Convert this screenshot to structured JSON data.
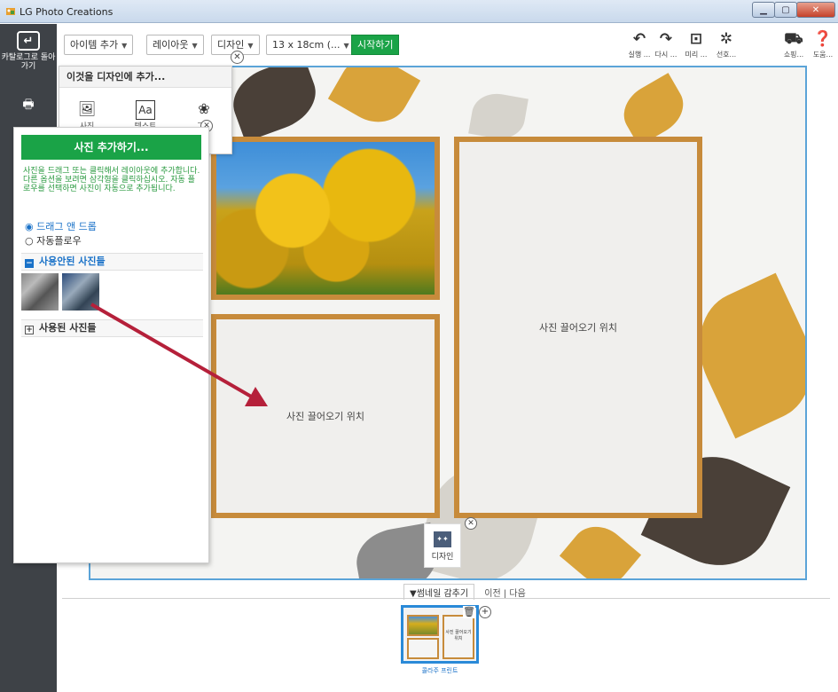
{
  "window": {
    "title": "LG Photo Creations"
  },
  "rail": {
    "back_label": "카탈로그로 돌아가기"
  },
  "toolbar": {
    "add_item": "아이템 추가",
    "layout": "레이아웃",
    "design": "디자인",
    "size": "13 x 18cm (...",
    "start": "시작하기",
    "undo": "실행 ...",
    "redo": "다시 ...",
    "preview": "미리 ...",
    "prefs": "선호...",
    "shop": "쇼핑...",
    "help": "도움..."
  },
  "add_popup": {
    "header": "이것을 디자인에 추가...",
    "items": [
      "사진",
      "텍스트",
      "그래"
    ]
  },
  "panel": {
    "add_photo": "사진 추가하기...",
    "help_text": "사진을 드래그 또는 클릭해서 레이아웃에 추가합니다. 다른 옵션을 보려면 삼각형을 클릭하십시오. 자동 플로우를 선택하면 사진이 자동으로 추가됩니다.",
    "radio_drag": "드래그 앤 드롭",
    "radio_auto": "자동플로우",
    "unused_section": "사용안된 사진들",
    "used_section": "사용된 사진들"
  },
  "canvas": {
    "drop_text": "사진 끌어오기 위치",
    "design_button": "디자인"
  },
  "strip": {
    "hide_thumbs": "▼썸네일 감추기",
    "prev": "이전",
    "next": "다음",
    "page_label": "콜라주 프린트",
    "mini_text": "사진 끌어오기 위치"
  },
  "colors": {
    "accent_green": "#1aa347",
    "frame_gold": "#c78b3b",
    "selection_blue": "#2a8ad8",
    "rail_dark": "#3e4247"
  }
}
